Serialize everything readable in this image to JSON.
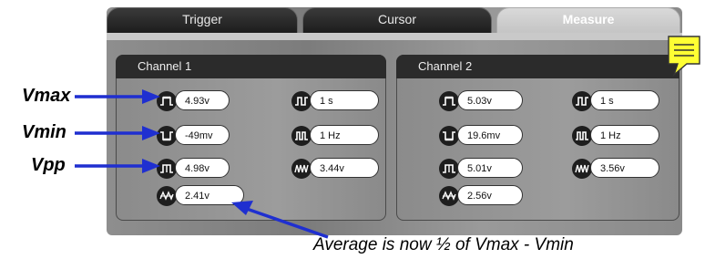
{
  "tabs": [
    {
      "label": "Trigger",
      "active": false
    },
    {
      "label": "Cursor",
      "active": false
    },
    {
      "label": "Measure",
      "active": true
    }
  ],
  "channel1": {
    "title": "Channel 1",
    "vmax": "4.93v",
    "vmin": "-49mv",
    "vpp": "4.98v",
    "average": "2.41v",
    "period": "1 s",
    "frequency": "1 Hz",
    "rms": "3.44v"
  },
  "channel2": {
    "title": "Channel 2",
    "vmax": "5.03v",
    "vmin": "19.6mv",
    "vpp": "5.01v",
    "average": "2.56v",
    "period": "1 s",
    "frequency": "1 Hz",
    "rms": "3.56v"
  },
  "annotations": {
    "vmax": "Vmax",
    "vmin": "Vmin",
    "vpp": "Vpp",
    "note": "Average is now ½ of Vmax - Vmin"
  },
  "colors": {
    "arrow": "#1f2fd0",
    "memo": "#ffff33",
    "tab_dark": "#1a1a1a"
  },
  "icons": [
    "vmax-icon",
    "vmin-icon",
    "vpp-icon",
    "average-icon",
    "period-icon",
    "frequency-icon",
    "rms-icon",
    "memo-icon"
  ]
}
